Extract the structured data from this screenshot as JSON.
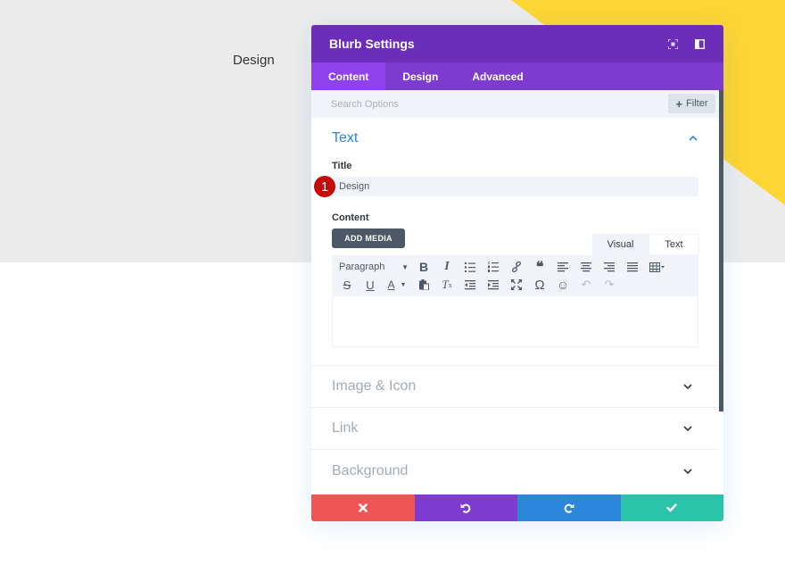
{
  "page": {
    "heading": "Design",
    "colors": {
      "background_gray": "#ececec",
      "accent_yellow": "#fed634"
    }
  },
  "modal": {
    "title": "Blurb Settings",
    "header_icons": [
      "focus-mode-icon",
      "sidebar-toggle-icon"
    ],
    "tabs": [
      {
        "label": "Content",
        "active": true
      },
      {
        "label": "Design",
        "active": false
      },
      {
        "label": "Advanced",
        "active": false
      }
    ],
    "search": {
      "placeholder": "Search Options",
      "value": ""
    },
    "filter_label": "Filter",
    "sections": {
      "text": {
        "title": "Text",
        "expanded": true,
        "title_field": {
          "label": "Title",
          "value": "Design",
          "step_badge": "1"
        },
        "content_field": {
          "label": "Content",
          "add_media_label": "ADD MEDIA",
          "mode_tabs": [
            "Visual",
            "Text"
          ],
          "format_select": "Paragraph",
          "toolbar_row1": [
            "bold",
            "italic",
            "bullet-list",
            "numbered-list",
            "link",
            "blockquote",
            "align-left",
            "align-center",
            "align-right",
            "align-justify",
            "table"
          ],
          "toolbar_row2": [
            "strikethrough",
            "underline",
            "text-color",
            "paste-as-text",
            "clear-formatting",
            "outdent",
            "indent",
            "fullscreen",
            "special-character",
            "emoji",
            "undo",
            "redo"
          ],
          "value": ""
        }
      },
      "collapsed": [
        {
          "title": "Image & Icon"
        },
        {
          "title": "Link"
        },
        {
          "title": "Background"
        }
      ]
    },
    "footer": [
      {
        "action": "cancel",
        "icon": "close-icon",
        "color": "#ef5555"
      },
      {
        "action": "undo",
        "icon": "undo-icon",
        "color": "#7e3bd0"
      },
      {
        "action": "redo",
        "icon": "redo-icon",
        "color": "#2b87da"
      },
      {
        "action": "save",
        "icon": "check-icon",
        "color": "#29c4a9"
      }
    ],
    "colors": {
      "header": "#6c2eb9",
      "tabs": "#7e3bd0",
      "active_tab": "#8f42ec",
      "section_title_active": "#2b87da",
      "badge": "#c40a0a"
    }
  }
}
